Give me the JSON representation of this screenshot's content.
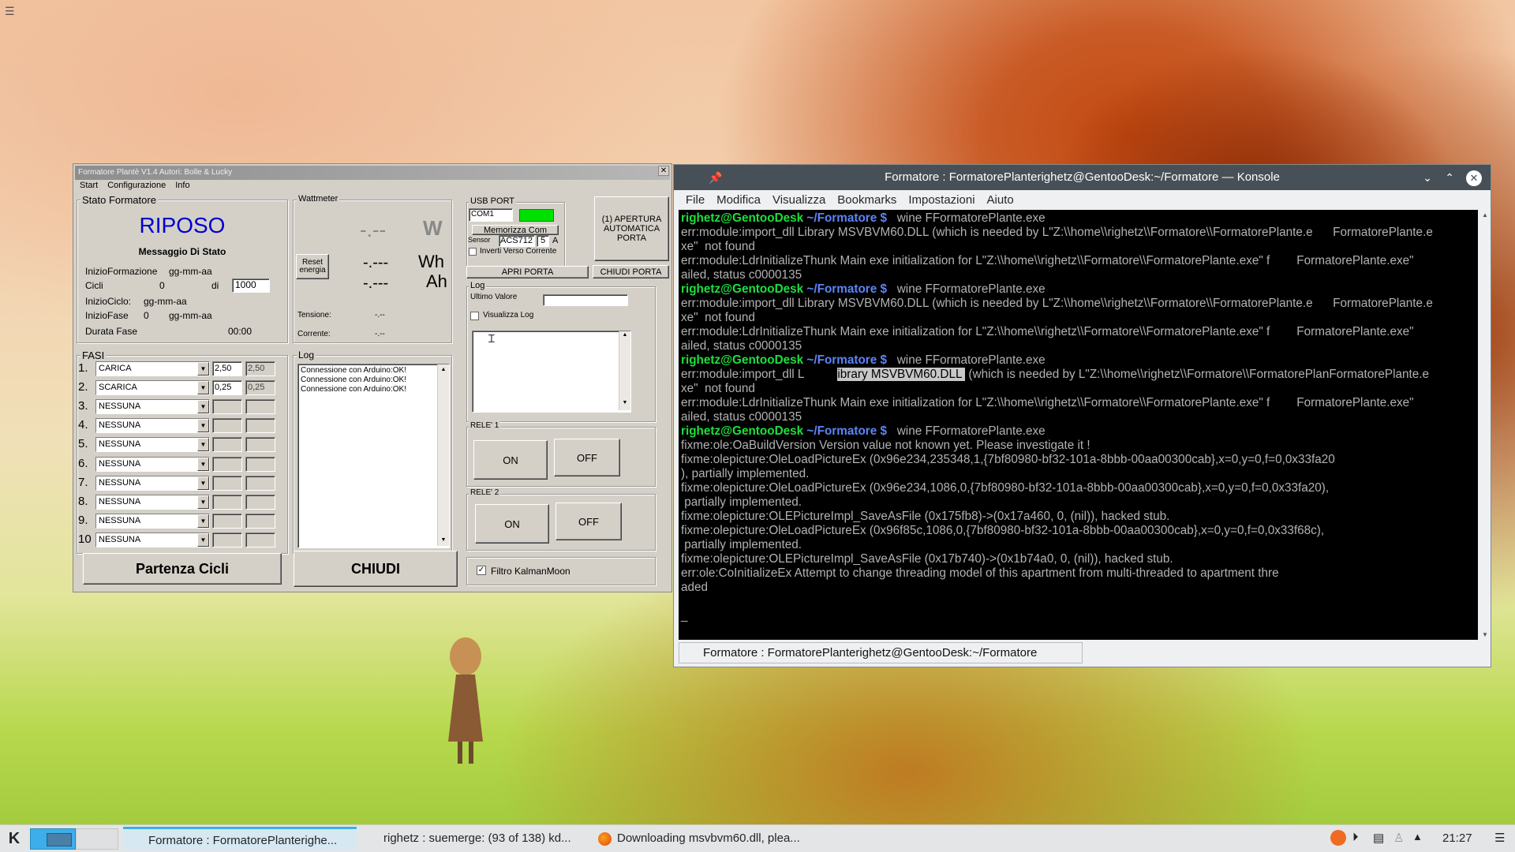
{
  "desktop": {
    "menu_icon": "hamburger-icon"
  },
  "plante": {
    "title": "Formatore Plantè V1.4 Autori: Bolle & Lucky",
    "menu": [
      "Start",
      "Configurazione",
      "Info"
    ],
    "stato": {
      "group": "Stato Formatore",
      "value": "RIPOSO",
      "msg": "Messaggio Di Stato",
      "inizio_formazione_label": "InizioFormazione",
      "inizio_formazione_value": "gg-mm-aa",
      "cicli_label": "Cicli",
      "cicli_count": "0",
      "di_label": "di",
      "cicli_total": "1000",
      "inizio_ciclo_label": "InizioCiclo:",
      "inizio_ciclo_value": "gg-mm-aa",
      "inizio_fase_label": "InizioFase",
      "inizio_fase_num": "0",
      "inizio_fase_value": "gg-mm-aa",
      "durata_fase_label": "Durata Fase",
      "durata_fase_value": "00:00"
    },
    "wattmeter": {
      "group": "Wattmeter",
      "watts": "-.--",
      "w_unit": "W",
      "reset_label": "Reset energia",
      "wh": "-.---",
      "wh_unit": "Wh",
      "ah": "-.---",
      "ah_unit": "Ah",
      "tensione_label": "Tensione:",
      "tensione_value": "-.--",
      "corrente_label": "Corrente:",
      "corrente_value": "-.--"
    },
    "usb": {
      "group": "USB PORT",
      "port": "COM1",
      "port_status_color": "#00e000",
      "memorizza_label": "Memorizza Com",
      "sensor_label": "Sensor",
      "sensor_value": "ACS712",
      "amp_value": "5",
      "amp_unit": "A",
      "inverti_label": "Inverti Verso Corrente",
      "apri_label": "APRI PORTA",
      "chiudi_label": "CHIUDI PORTA",
      "auto_label": "(1) APERTURA AUTOMATICA PORTA"
    },
    "logbox": {
      "group": "Log",
      "ultimo_label": "Ultimo Valore",
      "visualizza_label": "Visualizza Log"
    },
    "rele1": {
      "group": "RELE' 1",
      "on": "ON",
      "off": "OFF"
    },
    "rele2": {
      "group": "RELE' 2",
      "on": "ON",
      "off": "OFF"
    },
    "filtro_label": "Filtro KalmanMoon",
    "fasi": {
      "group": "FASI",
      "rows": [
        {
          "n": "1.",
          "mode": "CARICA",
          "v1": "2,50",
          "v2": "2,50"
        },
        {
          "n": "2.",
          "mode": "SCARICA",
          "v1": "0,25",
          "v2": "0,25"
        },
        {
          "n": "3.",
          "mode": "NESSUNA",
          "v1": "",
          "v2": ""
        },
        {
          "n": "4.",
          "mode": "NESSUNA",
          "v1": "",
          "v2": ""
        },
        {
          "n": "5.",
          "mode": "NESSUNA",
          "v1": "",
          "v2": ""
        },
        {
          "n": "6.",
          "mode": "NESSUNA",
          "v1": "",
          "v2": ""
        },
        {
          "n": "7.",
          "mode": "NESSUNA",
          "v1": "",
          "v2": ""
        },
        {
          "n": "8.",
          "mode": "NESSUNA",
          "v1": "",
          "v2": ""
        },
        {
          "n": "9.",
          "mode": "NESSUNA",
          "v1": "",
          "v2": ""
        },
        {
          "n": "10",
          "mode": "NESSUNA",
          "v1": "",
          "v2": ""
        }
      ]
    },
    "log": {
      "group": "Log",
      "lines": [
        "Connessione con Arduino:OK!",
        "Connessione con Arduino:OK!",
        "Connessione con Arduino:OK!"
      ]
    },
    "partenza_label": "Partenza Cicli",
    "chiudi_label": "CHIUDI"
  },
  "konsole": {
    "title": "Formatore : FormatorePlanterighetz@GentooDesk:~/Formatore — Konsole",
    "menu": [
      "File",
      "Modifica",
      "Visualizza",
      "Bookmarks",
      "Impostazioni",
      "Aiuto"
    ],
    "prompt_user": "righetz@GentooDesk",
    "prompt_path": " ~/Formatore $",
    "lines": [
      {
        "t": "prompt",
        "cmd": "   wine FFormatorePlante.exe"
      },
      {
        "t": "text",
        "v": "err:module:import_dll Library MSVBVM60.DLL (which is needed by L\"Z:\\\\home\\\\righetz\\\\Formatore\\\\FormatorePlante.e      FormatorePlante.e"
      },
      {
        "t": "text",
        "v": "xe\"  not found"
      },
      {
        "t": "text",
        "v": "err:module:LdrInitializeThunk Main exe initialization for L\"Z:\\\\home\\\\righetz\\\\Formatore\\\\FormatorePlante.exe\" f        FormatorePlante.exe\""
      },
      {
        "t": "text",
        "v": "ailed, status c0000135"
      },
      {
        "t": "prompt",
        "cmd": "   wine FFormatorePlante.exe"
      },
      {
        "t": "text",
        "v": "err:module:import_dll Library MSVBVM60.DLL (which is needed by L\"Z:\\\\home\\\\righetz\\\\Formatore\\\\FormatorePlante.e      FormatorePlante.e"
      },
      {
        "t": "text",
        "v": "xe\"  not found"
      },
      {
        "t": "text",
        "v": "err:module:LdrInitializeThunk Main exe initialization for L\"Z:\\\\home\\\\righetz\\\\Formatore\\\\FormatorePlante.exe\" f        FormatorePlante.exe\""
      },
      {
        "t": "text",
        "v": "ailed, status c0000135"
      },
      {
        "t": "prompt",
        "cmd": "   wine FFormatorePlante.exe"
      },
      {
        "t": "sel",
        "a": "err:module:import_dll L          ",
        "s": "ibrary MSVBVM60.DLL ",
        "b": " (which is needed by L\"Z:\\\\home\\\\righetz\\\\Formatore\\\\FormatorePlanFormatorePlante.e"
      },
      {
        "t": "text",
        "v": "xe\"  not found"
      },
      {
        "t": "text",
        "v": "err:module:LdrInitializeThunk Main exe initialization for L\"Z:\\\\home\\\\righetz\\\\Formatore\\\\FormatorePlante.exe\" f        FormatorePlante.exe\""
      },
      {
        "t": "text",
        "v": "ailed, status c0000135"
      },
      {
        "t": "prompt",
        "cmd": "   wine FFormatorePlante.exe"
      },
      {
        "t": "text",
        "v": "fixme:ole:OaBuildVersion Version value not known yet. Please investigate it !"
      },
      {
        "t": "text",
        "v": "fixme:olepicture:OleLoadPictureEx (0x96e234,235348,1,{7bf80980-bf32-101a-8bbb-00aa00300cab},x=0,y=0,f=0,0x33fa20"
      },
      {
        "t": "text",
        "v": "), partially implemented."
      },
      {
        "t": "text",
        "v": "fixme:olepicture:OleLoadPictureEx (0x96e234,1086,0,{7bf80980-bf32-101a-8bbb-00aa00300cab},x=0,y=0,f=0,0x33fa20),"
      },
      {
        "t": "text",
        "v": " partially implemented."
      },
      {
        "t": "text",
        "v": "fixme:olepicture:OLEPictureImpl_SaveAsFile (0x175fb8)->(0x17a460, 0, (nil)), hacked stub."
      },
      {
        "t": "text",
        "v": "fixme:olepicture:OleLoadPictureEx (0x96f85c,1086,0,{7bf80980-bf32-101a-8bbb-00aa00300cab},x=0,y=0,f=0,0x33f68c),"
      },
      {
        "t": "text",
        "v": " partially implemented."
      },
      {
        "t": "text",
        "v": "fixme:olepicture:OLEPictureImpl_SaveAsFile (0x17b740)->(0x1b74a0, 0, (nil)), hacked stub."
      },
      {
        "t": "text",
        "v": "err:ole:CoInitializeEx Attempt to change threading model of this apartment from multi-threaded to apartment thre"
      },
      {
        "t": "text",
        "v": "aded"
      },
      {
        "t": "text",
        "v": ""
      },
      {
        "t": "text",
        "v": "_"
      }
    ],
    "tab": "Formatore : FormatorePlanterighetz@GentooDesk:~/Formatore"
  },
  "taskbar": {
    "launcher_icon": "kde-logo-icon",
    "items": [
      "Formatore : FormatorePlanterighe...",
      "righetz : suemerge: (93 of 138) kd...",
      "Downloading msvbvm60.dll, plea..."
    ],
    "clock": "21:27"
  }
}
